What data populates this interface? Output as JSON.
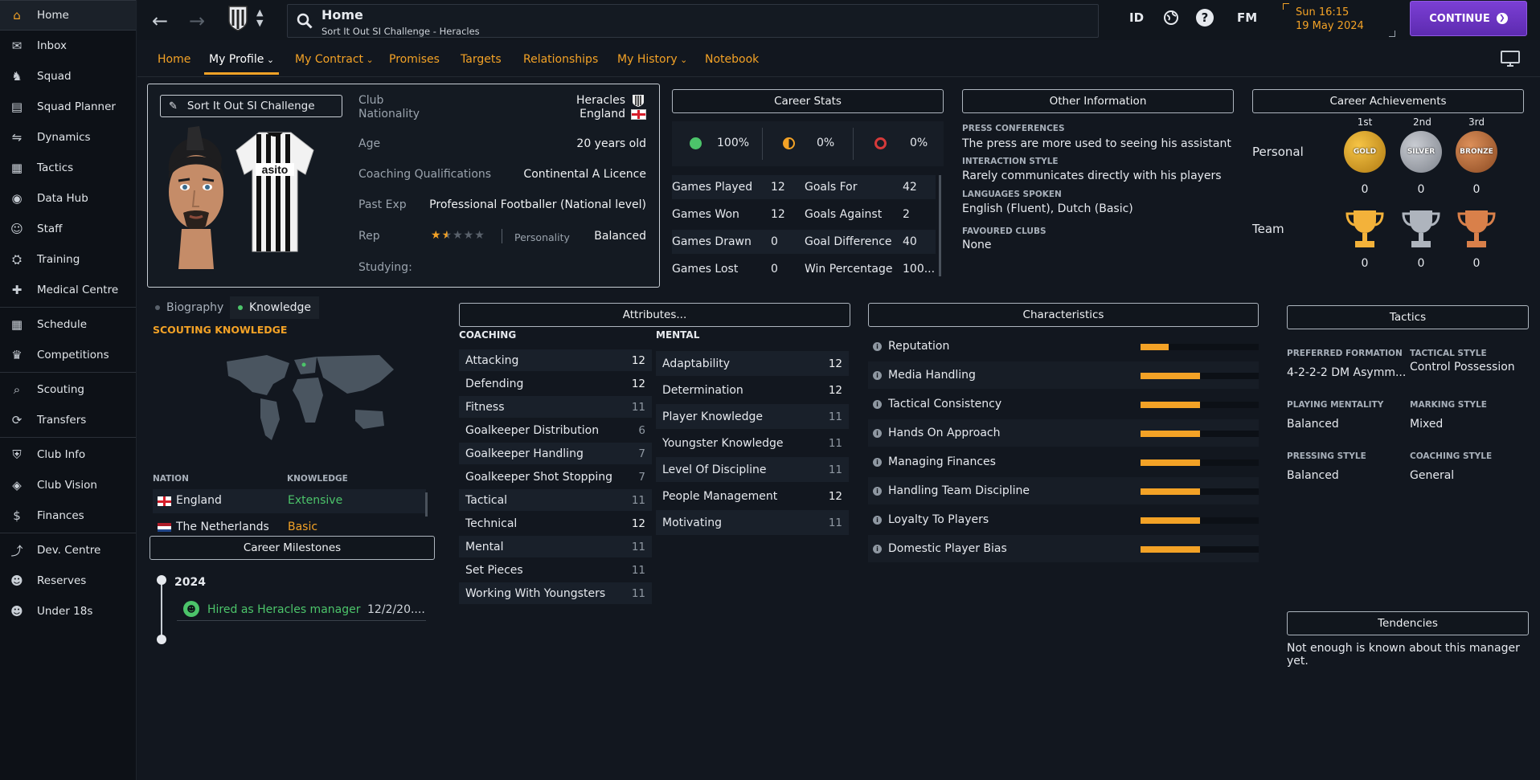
{
  "sidebar": {
    "items": [
      {
        "label": "Home",
        "icon": "home-icon",
        "active": true
      },
      {
        "label": "Inbox",
        "icon": "inbox-icon"
      },
      {
        "label": "Squad",
        "icon": "squad-icon"
      },
      {
        "label": "Squad Planner",
        "icon": "planner-icon"
      },
      {
        "label": "Dynamics",
        "icon": "dynamics-icon"
      },
      {
        "label": "Tactics",
        "icon": "tactics-icon"
      },
      {
        "label": "Data Hub",
        "icon": "datahub-icon"
      },
      {
        "label": "Staff",
        "icon": "staff-icon"
      },
      {
        "label": "Training",
        "icon": "training-icon"
      },
      {
        "label": "Medical Centre",
        "icon": "medical-icon"
      },
      {
        "label": "Schedule",
        "icon": "schedule-icon"
      },
      {
        "label": "Competitions",
        "icon": "trophy-icon"
      },
      {
        "label": "Scouting",
        "icon": "scouting-icon"
      },
      {
        "label": "Transfers",
        "icon": "transfers-icon"
      },
      {
        "label": "Club Info",
        "icon": "club-info-icon"
      },
      {
        "label": "Club Vision",
        "icon": "club-vision-icon"
      },
      {
        "label": "Finances",
        "icon": "finances-icon"
      },
      {
        "label": "Dev. Centre",
        "icon": "dev-centre-icon"
      },
      {
        "label": "Reserves",
        "icon": "reserves-icon"
      },
      {
        "label": "Under 18s",
        "icon": "under18-icon"
      }
    ]
  },
  "topbar": {
    "title": "Home",
    "subtitle": "Sort It Out SI Challenge - Heracles",
    "id_label": "ID",
    "fm_label": "FM",
    "help_label": "?",
    "time": "Sun 16:15",
    "date": "19 May 2024",
    "continue_label": "CONTINUE"
  },
  "tabs": [
    "Home",
    "My Profile",
    "My Contract",
    "Promises",
    "Targets",
    "Relationships",
    "My History",
    "Notebook"
  ],
  "profile": {
    "name": "Sort It Out SI Challenge",
    "club_label": "Club",
    "club": "Heracles",
    "nationality_label": "Nationality",
    "nationality": "England",
    "age_label": "Age",
    "age": "20 years old",
    "qual_label": "Coaching Qualifications",
    "qual": "Continental A Licence",
    "past_label": "Past Exp",
    "past": "Professional Footballer (National level)",
    "rep_label": "Rep",
    "rep_stars": 1.5,
    "personality_label": "Personality",
    "personality": "Balanced",
    "studying_label": "Studying:",
    "shirt_sponsor": "asito"
  },
  "career_stats": {
    "title": "Career Stats",
    "win_pct": "100%",
    "draw_pct": "0%",
    "loss_pct": "0%",
    "rows": [
      {
        "l1": "Games Played",
        "v1": "12",
        "l2": "Goals For",
        "v2": "42"
      },
      {
        "l1": "Games Won",
        "v1": "12",
        "l2": "Goals Against",
        "v2": "2"
      },
      {
        "l1": "Games Drawn",
        "v1": "0",
        "l2": "Goal Difference",
        "v2": "40"
      },
      {
        "l1": "Games Lost",
        "v1": "0",
        "l2": "Win Percentage",
        "v2": "100..."
      }
    ]
  },
  "other_info": {
    "title": "Other Information",
    "press_label": "PRESS CONFERENCES",
    "press": "The press are more used to seeing his assistant",
    "interaction_label": "INTERACTION STYLE",
    "interaction": "Rarely communicates directly with his players",
    "languages_label": "LANGUAGES SPOKEN",
    "languages": "English (Fluent), Dutch (Basic)",
    "clubs_label": "FAVOURED CLUBS",
    "clubs": "None"
  },
  "achievements": {
    "title": "Career Achievements",
    "cols": [
      "1st",
      "2nd",
      "3rd"
    ],
    "medals": [
      "GOLD",
      "SILVER",
      "BRONZE"
    ],
    "personal_label": "Personal",
    "personal": [
      "0",
      "0",
      "0"
    ],
    "team_label": "Team",
    "team": [
      "0",
      "0",
      "0"
    ]
  },
  "knowledge": {
    "tab_bio": "Biography",
    "tab_knowledge": "Knowledge",
    "heading": "SCOUTING KNOWLEDGE",
    "col_nation": "NATION",
    "col_knowledge": "KNOWLEDGE",
    "rows": [
      {
        "nation": "England",
        "level": "Extensive",
        "color": "#4cc46a"
      },
      {
        "nation": "The Netherlands",
        "level": "Basic",
        "color": "#f3a226"
      }
    ]
  },
  "milestones": {
    "title": "Career Milestones",
    "year": "2024",
    "event": "Hired as Heracles manager",
    "date": "12/2/20...."
  },
  "attributes": {
    "title": "Attributes...",
    "coaching_label": "COACHING",
    "mental_label": "MENTAL",
    "coaching": [
      {
        "name": "Attacking",
        "value": "12"
      },
      {
        "name": "Defending",
        "value": "12"
      },
      {
        "name": "Fitness",
        "value": "11"
      },
      {
        "name": "Goalkeeper Distribution",
        "value": "6"
      },
      {
        "name": "Goalkeeper Handling",
        "value": "7"
      },
      {
        "name": "Goalkeeper Shot Stopping",
        "value": "7"
      },
      {
        "name": "Tactical",
        "value": "11"
      },
      {
        "name": "Technical",
        "value": "12"
      },
      {
        "name": "Mental",
        "value": "11"
      },
      {
        "name": "Set Pieces",
        "value": "11"
      },
      {
        "name": "Working With Youngsters",
        "value": "11"
      }
    ],
    "mental": [
      {
        "name": "Adaptability",
        "value": "12"
      },
      {
        "name": "Determination",
        "value": "12"
      },
      {
        "name": "Player Knowledge",
        "value": "11"
      },
      {
        "name": "Youngster Knowledge",
        "value": "11"
      },
      {
        "name": "Level Of Discipline",
        "value": "11"
      },
      {
        "name": "People Management",
        "value": "12"
      },
      {
        "name": "Motivating",
        "value": "11"
      }
    ]
  },
  "characteristics": {
    "title": "Characteristics",
    "rows": [
      {
        "name": "Reputation",
        "level": 0.24
      },
      {
        "name": "Media Handling",
        "level": 0.5
      },
      {
        "name": "Tactical Consistency",
        "level": 0.5
      },
      {
        "name": "Hands On Approach",
        "level": 0.5
      },
      {
        "name": "Managing Finances",
        "level": 0.5
      },
      {
        "name": "Handling Team Discipline",
        "level": 0.5
      },
      {
        "name": "Loyalty To Players",
        "level": 0.5
      },
      {
        "name": "Domestic Player Bias",
        "level": 0.5
      }
    ]
  },
  "tactics": {
    "title": "Tactics",
    "formation_label": "PREFERRED FORMATION",
    "formation": "4-2-2-2 DM Asymm...",
    "style_label": "TACTICAL STYLE",
    "style": "Control Possession",
    "mentality_label": "PLAYING MENTALITY",
    "mentality": "Balanced",
    "marking_label": "MARKING STYLE",
    "marking": "Mixed",
    "pressing_label": "PRESSING STYLE",
    "pressing": "Balanced",
    "coaching_label": "COACHING STYLE",
    "coaching": "General"
  },
  "tendencies": {
    "title": "Tendencies",
    "text": "Not enough is known about this manager yet."
  },
  "colors": {
    "accent": "#f3a226",
    "continue": "#6a33c4",
    "green": "#4cc46a"
  }
}
